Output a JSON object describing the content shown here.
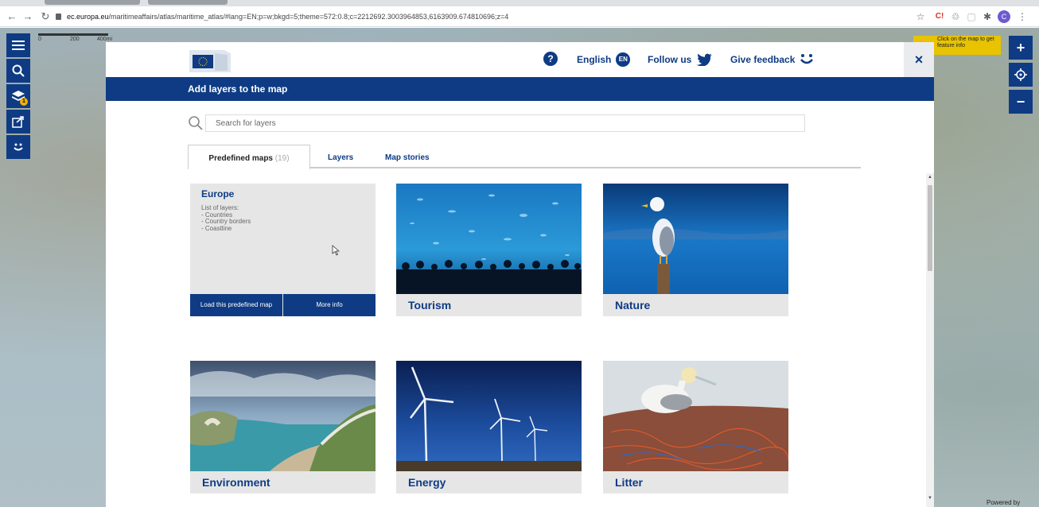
{
  "browser": {
    "url_host": "ec.europa.eu",
    "url_path": "/maritimeaffairs/atlas/maritime_atlas/#lang=EN;p=w;bkgd=5;theme=572:0.8;c=2212692.3003964853,6163909.674810696;z=4",
    "profile_initial": "C",
    "ext_badge": "C!"
  },
  "map": {
    "scale_labels": [
      "0",
      "200",
      "400mi"
    ],
    "hint_text": "Click on the map to get feature info",
    "layer_badge": "1",
    "powered_by": "Powered by"
  },
  "modal": {
    "help_label": "?",
    "language": "English",
    "language_code": "EN",
    "follow_us": "Follow us",
    "give_feedback": "Give feedback",
    "close_label": "×",
    "header_title": "Add layers to the map",
    "search_placeholder": "Search for layers",
    "tabs": [
      {
        "label": "Predefined maps",
        "count": "(19)"
      },
      {
        "label": "Layers"
      },
      {
        "label": "Map stories"
      }
    ],
    "europe_card": {
      "title": "Europe",
      "layers_heading": "List of layers:",
      "layers": [
        "- Countries",
        "- Country borders",
        "- Coastline"
      ],
      "load_button": "Load this predefined map",
      "more_button": "More info"
    },
    "cards": [
      {
        "title": "Tourism"
      },
      {
        "title": "Nature"
      },
      {
        "title": "Environment"
      },
      {
        "title": "Energy"
      },
      {
        "title": "Litter"
      }
    ]
  },
  "colors": {
    "brand_blue": "#0e3b84",
    "hint_yellow": "#e7c300"
  }
}
